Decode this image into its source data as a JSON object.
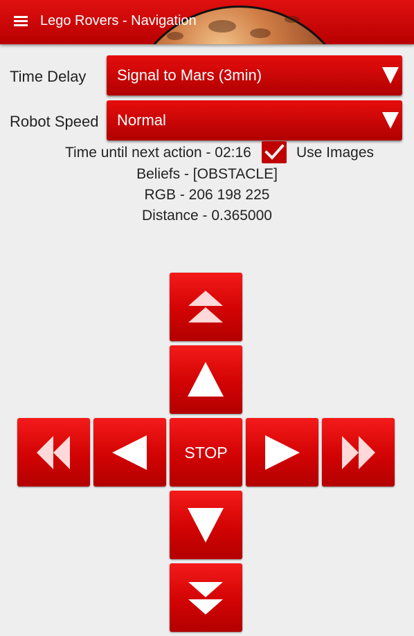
{
  "app": {
    "title": "Lego Rovers - Navigation"
  },
  "settings": {
    "time_delay": {
      "label": "Time Delay",
      "value": "Signal to Mars (3min)"
    },
    "robot_speed": {
      "label": "Robot Speed",
      "value": "Normal"
    }
  },
  "status": {
    "timer": "Time until next action - 02:16",
    "use_images": {
      "label": "Use Images",
      "checked": true
    },
    "beliefs": "Beliefs - [OBSTACLE]",
    "rgb": "RGB - 206 198 225",
    "distance": "Distance - 0.365000"
  },
  "controls": {
    "stop_label": "STOP",
    "buttons": [
      "fast-forward",
      "forward",
      "fast-left",
      "left",
      "stop",
      "right",
      "fast-right",
      "backward",
      "fast-backward"
    ]
  },
  "colors": {
    "accent": "#d00000",
    "background": "#eeeeee",
    "text": "#222222"
  }
}
